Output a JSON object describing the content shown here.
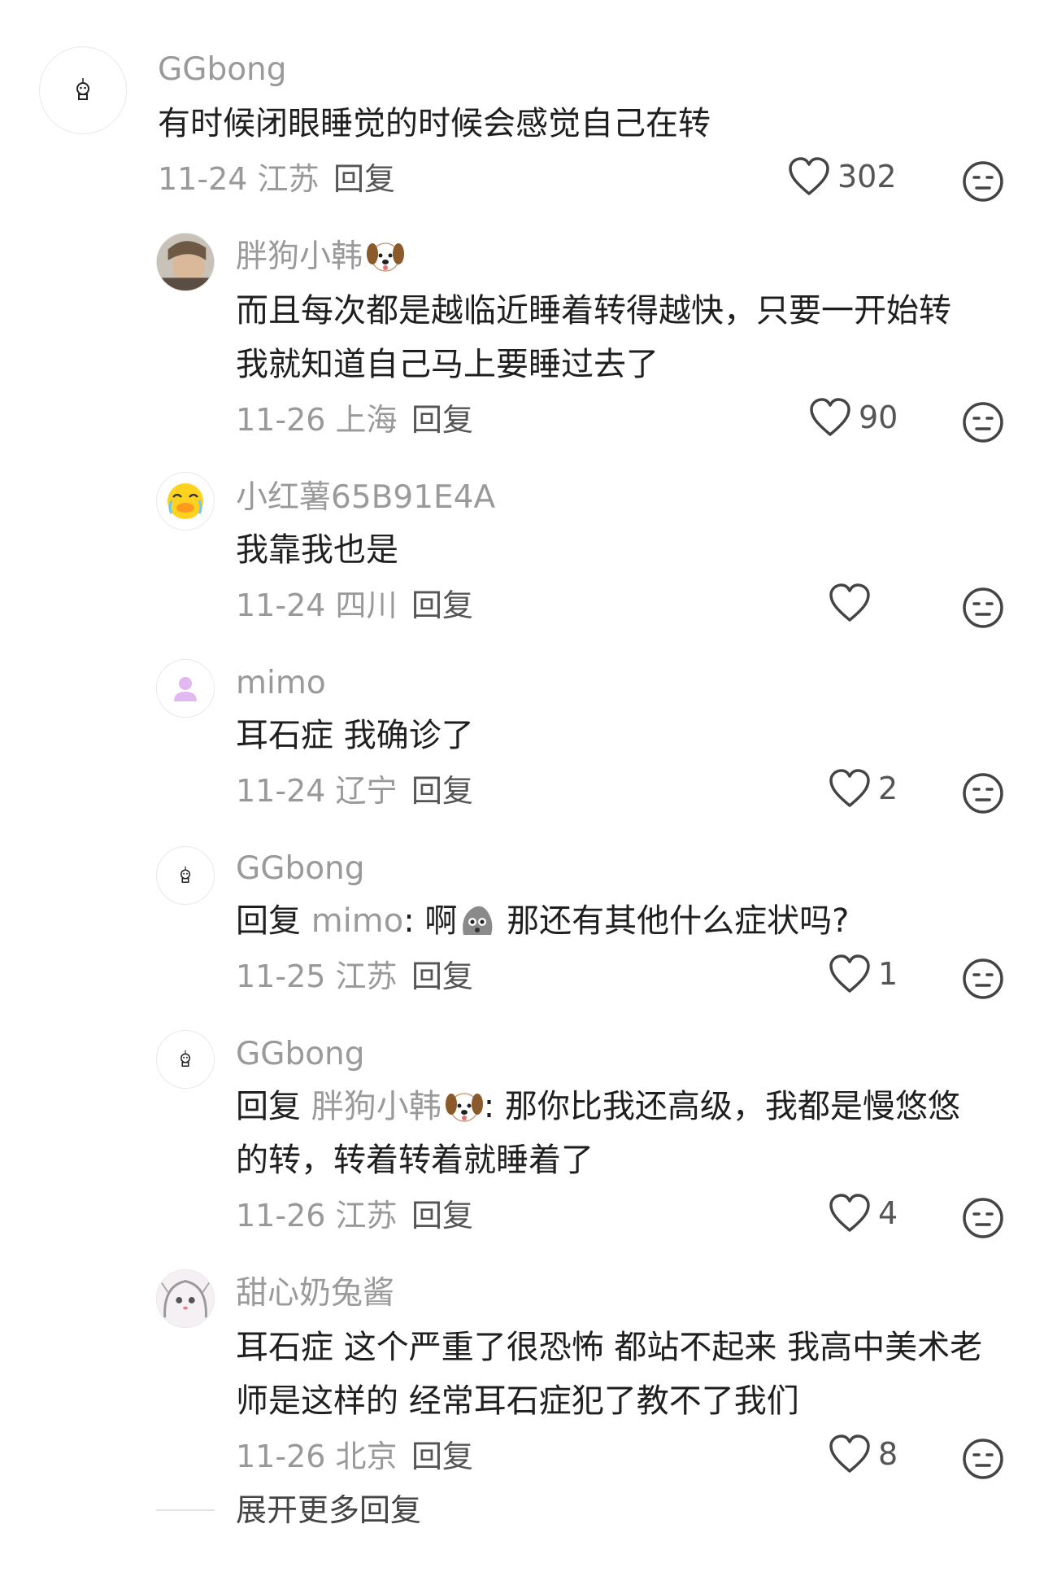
{
  "comments": [
    {
      "name": "GGbong",
      "text": "有时候闭眼睡觉的时候会感觉自己在转",
      "date": "11-24",
      "location": "江苏",
      "reply_label": "回复",
      "likes": "302",
      "avatar": "robot-avatar"
    },
    {
      "name": "胖狗小韩",
      "text1": "而且每次都是越临近睡着转得越快，只要一开始转",
      "text2": "我就知道自己马上要睡过去了",
      "date": "11-26",
      "location": "上海",
      "reply_label": "回复",
      "likes": "90",
      "avatar": "selfie-avatar"
    },
    {
      "name": "小红薯65B91E4A",
      "text": "我靠我也是",
      "date": "11-24",
      "location": "四川",
      "reply_label": "回复",
      "likes": "",
      "avatar": "crying-duck-avatar"
    },
    {
      "name": "mimo",
      "text": "耳石症 我确诊了",
      "date": "11-24",
      "location": "辽宁",
      "reply_label": "回复",
      "likes": "2",
      "avatar": "default-person-avatar"
    },
    {
      "name": "GGbong",
      "reply_prefix": "回复",
      "mention": "mimo",
      "text_a": ": 啊",
      "text_b": " 那还有其他什么症状吗?",
      "date": "11-25",
      "location": "江苏",
      "reply_label": "回复",
      "likes": "1",
      "avatar": "robot-avatar"
    },
    {
      "name": "GGbong",
      "reply_prefix": "回复",
      "mention": "胖狗小韩",
      "text_a": ": 那你比我还高级，我都是慢悠悠",
      "text2": "的转，转着转着就睡着了",
      "date": "11-26",
      "location": "江苏",
      "reply_label": "回复",
      "likes": "4",
      "avatar": "robot-avatar"
    },
    {
      "name": "甜心奶兔酱",
      "text1": "耳石症 这个严重了很恐怖 都站不起来 我高中美术老",
      "text2": "师是这样的 经常耳石症犯了教不了我们",
      "date": "11-26",
      "location": "北京",
      "reply_label": "回复",
      "likes": "8",
      "avatar": "anime-girl-avatar"
    }
  ],
  "more_replies": "展开更多回复",
  "colors": {
    "name": "#9a9a9a",
    "text": "#1f1f1f",
    "meta": "#999999"
  }
}
